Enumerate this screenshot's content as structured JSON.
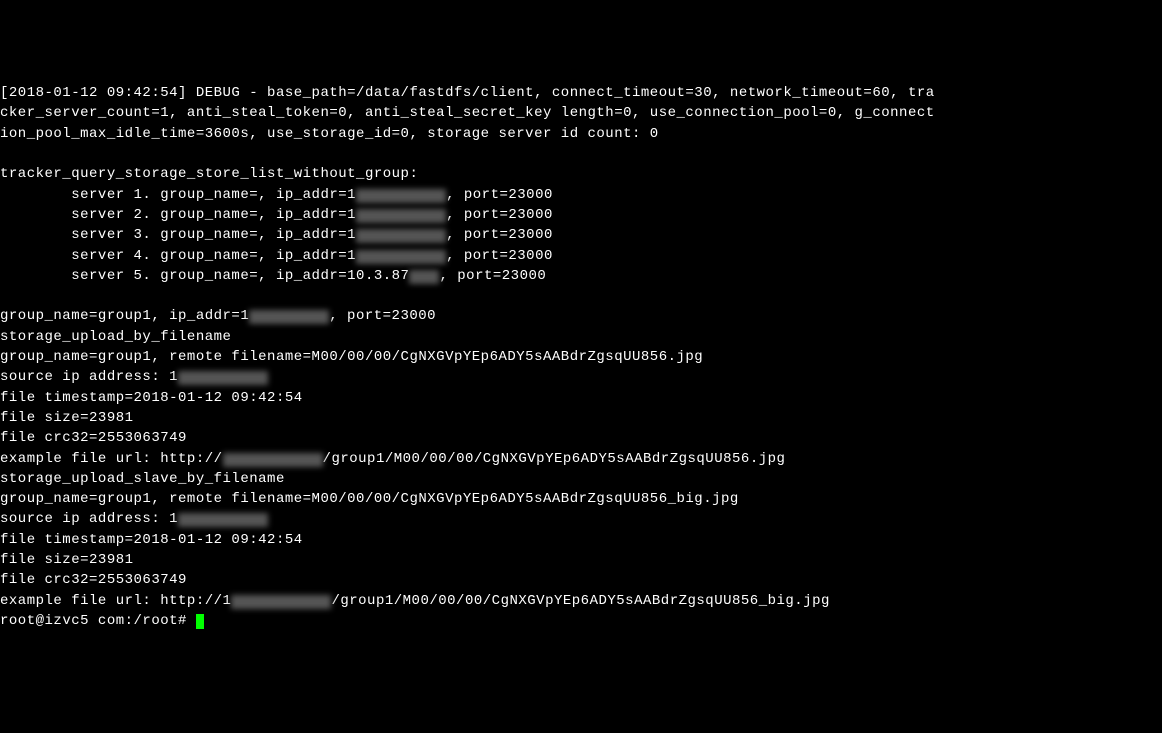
{
  "debug_line1": "[2018-01-12 09:42:54] DEBUG - base_path=/data/fastdfs/client, connect_timeout=30, network_timeout=60, tra",
  "debug_line2": "cker_server_count=1, anti_steal_token=0, anti_steal_secret_key length=0, use_connection_pool=0, g_connect",
  "debug_line3": "ion_pool_max_idle_time=3600s, use_storage_id=0, storage server id count: 0",
  "tracker_header": "tracker_query_storage_store_list_without_group:",
  "server1_prefix": "        server 1. group_name=, ip_addr=1",
  "server1_suffix": ", port=23000",
  "server2_prefix": "        server 2. group_name=, ip_addr=1",
  "server2_suffix": ", port=23000",
  "server3_prefix": "        server 3. group_name=, ip_addr=1",
  "server3_suffix": ", port=23000",
  "server4_prefix": "        server 4. group_name=, ip_addr=1",
  "server4_suffix": ", port=23000",
  "server5_prefix": "        server 5. group_name=, ip_addr=10.3.87",
  "server5_suffix": ", port=23000",
  "group_prefix": "group_name=group1, ip_addr=1",
  "group_suffix": ", port=23000",
  "upload_filename": "storage_upload_by_filename",
  "remote_filename": "group_name=group1, remote filename=M00/00/00/CgNXGVpYEp6ADY5sAABdrZgsqUU856.jpg",
  "source_ip_prefix": "source ip address: 1",
  "file_timestamp": "file timestamp=2018-01-12 09:42:54",
  "file_size": "file size=23981",
  "file_crc32": "file crc32=2553063749",
  "example_url_prefix": "example file url: http://",
  "example_url_suffix": "/group1/M00/00/00/CgNXGVpYEp6ADY5sAABdrZgsqUU856.jpg",
  "upload_slave": "storage_upload_slave_by_filename",
  "remote_filename_big": "group_name=group1, remote filename=M00/00/00/CgNXGVpYEp6ADY5sAABdrZgsqUU856_big.jpg",
  "source_ip_prefix2": "source ip address: 1",
  "file_timestamp2": "file timestamp=2018-01-12 09:42:54",
  "file_size2": "file size=23981",
  "file_crc32_2": "file crc32=2553063749",
  "example_url_big_prefix": "example file url: http://1",
  "example_url_big_suffix": "/group1/M00/00/00/CgNXGVpYEp6ADY5sAABdrZgsqUU856_big.jpg",
  "prompt_prefix": "root@",
  "prompt_mid": "izvc5 com:/root# "
}
